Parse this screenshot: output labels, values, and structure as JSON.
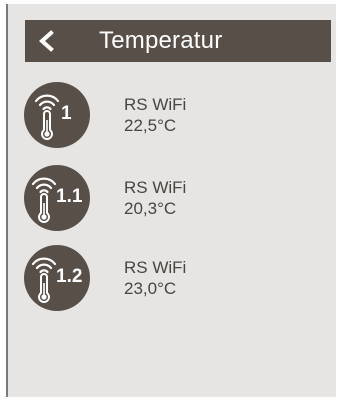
{
  "header": {
    "back_icon": "chevron-left-icon",
    "title": "Temperatur"
  },
  "sensors": [
    {
      "number": "1",
      "name": "RS WiFi",
      "temperature": "22,5°C",
      "icon": "wifi-thermometer-icon"
    },
    {
      "number": "1.1",
      "name": "RS WiFi",
      "temperature": "20,3°C",
      "icon": "wifi-thermometer-icon"
    },
    {
      "number": "1.2",
      "name": "RS WiFi",
      "temperature": "23,0°C",
      "icon": "wifi-thermometer-icon"
    }
  ],
  "colors": {
    "header_bg": "#584f48",
    "icon_bg": "#584f48",
    "screen_bg": "#e6e5e3",
    "text": "#4a4440"
  }
}
